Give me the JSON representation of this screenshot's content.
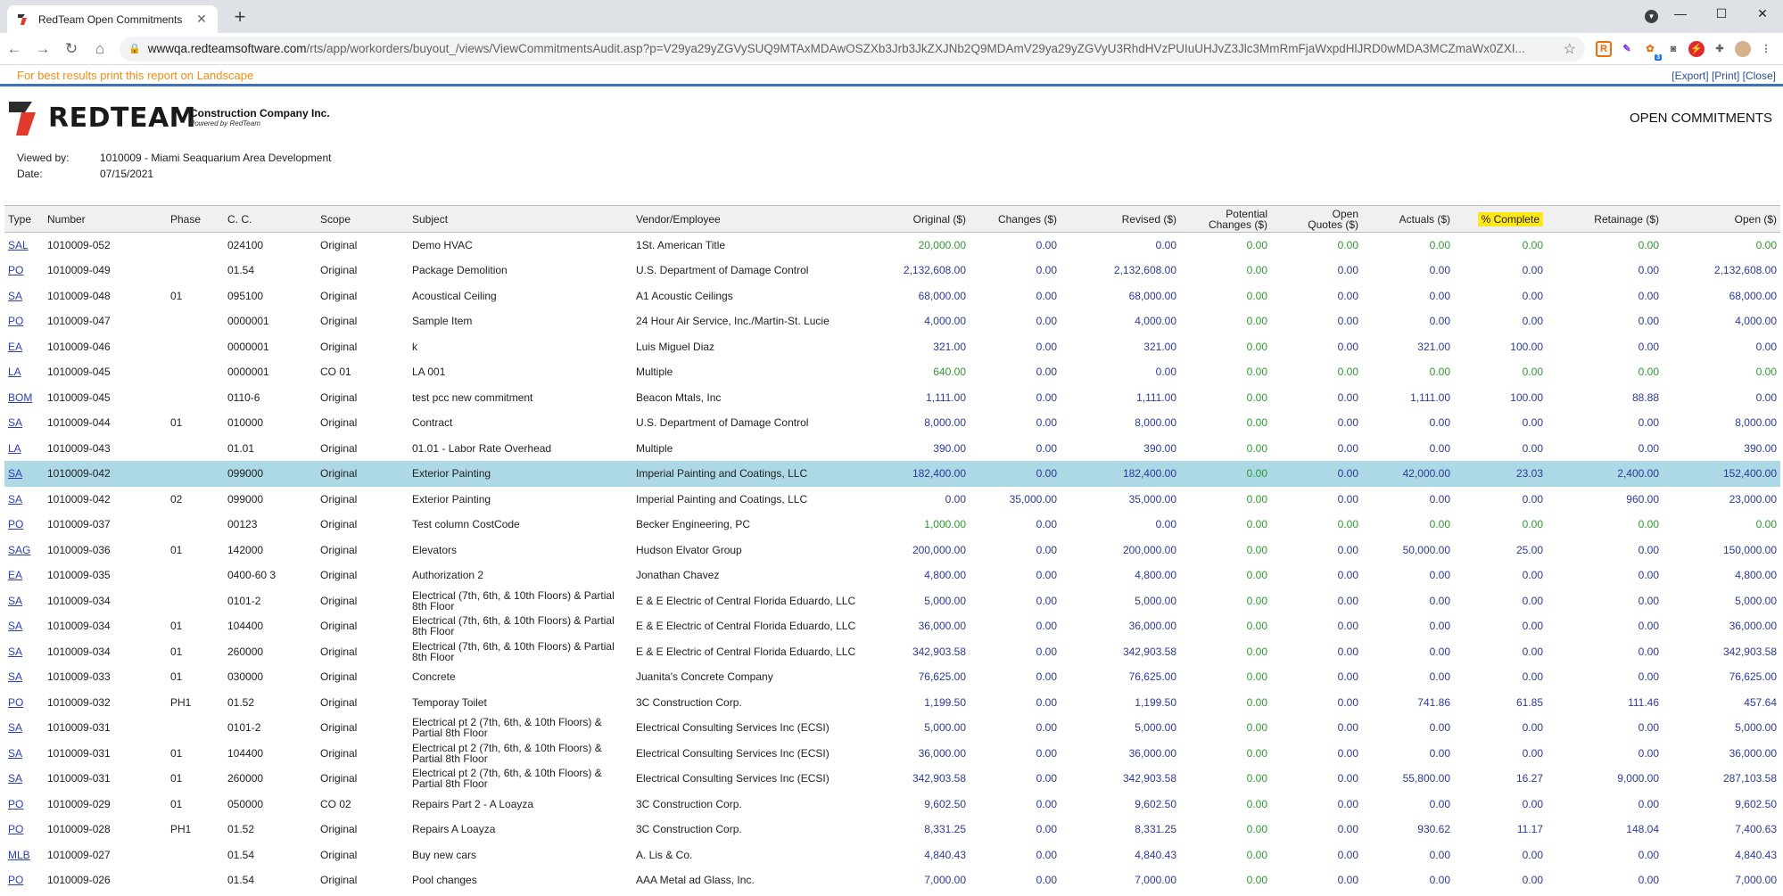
{
  "browser": {
    "tab_title": "RedTeam Open Commitments",
    "url_host": "wwwqa.redteamsoftware.com",
    "url_rest": "/rts/app/workorders/buyout_/views/ViewCommitmentsAudit.asp?p=V29ya29yZGVySUQ9MTAxMDAwOSZXb3Jrb3JkZXJNb2Q9MDAmV29ya29yZGVyU3RhdHVzPUIuUHJvZ3Jlc3MmRmFjaWxpdHlJRD0wMDA3MCZmaWx0ZXI...",
    "ext_badge": "3"
  },
  "report_bar": {
    "hint": "For best results print this report on Landscape",
    "export": "[Export]",
    "print": "[Print]",
    "close": "[Close]"
  },
  "header": {
    "logo_word": "REDTEAM",
    "company": "Construction Company Inc.",
    "powered": "Powered by RedTeam",
    "report_title": "OPEN COMMITMENTS",
    "viewed_by_label": "Viewed by:",
    "viewed_by": "1010009 - Miami Seaquarium Area Development",
    "date_label": "Date:",
    "date": "07/15/2021"
  },
  "columns": {
    "type": "Type",
    "number": "Number",
    "phase": "Phase",
    "cc": "C. C.",
    "scope": "Scope",
    "subject": "Subject",
    "vendor": "Vendor/Employee",
    "original": "Original ($)",
    "changes": "Changes ($)",
    "revised": "Revised ($)",
    "potential_1": "Potential",
    "potential_2": "Changes ($)",
    "open_quotes_1": "Open",
    "open_quotes_2": "Quotes ($)",
    "actuals": "Actuals ($)",
    "pct_complete": "% Complete",
    "retainage": "Retainage ($)",
    "open": "Open ($)"
  },
  "rows": [
    {
      "type": "SAL",
      "number": "1010009-052",
      "phase": "",
      "cc": "024100",
      "scope": "Original",
      "subject": "Demo HVAC",
      "vendor": "1St. American Title",
      "original": "20,000.00",
      "changes": "0.00",
      "revised": "0.00",
      "potential": "0.00",
      "quotes": "0.00",
      "actuals": "0.00",
      "pct": "0.00",
      "retainage": "0.00",
      "open": "0.00",
      "green": [
        "original",
        "potential",
        "quotes",
        "actuals",
        "pct",
        "retainage",
        "open"
      ]
    },
    {
      "type": "PO",
      "number": "1010009-049",
      "phase": "",
      "cc": "01.54",
      "scope": "Original",
      "subject": "Package Demolition",
      "vendor": "U.S. Department of Damage Control",
      "original": "2,132,608.00",
      "changes": "0.00",
      "revised": "2,132,608.00",
      "potential": "0.00",
      "quotes": "0.00",
      "actuals": "0.00",
      "pct": "0.00",
      "retainage": "0.00",
      "open": "2,132,608.00",
      "green": [
        "potential"
      ]
    },
    {
      "type": "SA",
      "number": "1010009-048",
      "phase": "01",
      "cc": "095100",
      "scope": "Original",
      "subject": "Acoustical Ceiling",
      "vendor": "A1 Acoustic Ceilings",
      "original": "68,000.00",
      "changes": "0.00",
      "revised": "68,000.00",
      "potential": "0.00",
      "quotes": "0.00",
      "actuals": "0.00",
      "pct": "0.00",
      "retainage": "0.00",
      "open": "68,000.00",
      "green": [
        "potential"
      ]
    },
    {
      "type": "PO",
      "number": "1010009-047",
      "phase": "",
      "cc": "0000001",
      "scope": "Original",
      "subject": "Sample Item",
      "vendor": "24 Hour Air Service, Inc./Martin-St. Lucie",
      "original": "4,000.00",
      "changes": "0.00",
      "revised": "4,000.00",
      "potential": "0.00",
      "quotes": "0.00",
      "actuals": "0.00",
      "pct": "0.00",
      "retainage": "0.00",
      "open": "4,000.00",
      "green": [
        "potential"
      ]
    },
    {
      "type": "EA",
      "number": "1010009-046",
      "phase": "",
      "cc": "0000001",
      "scope": "Original",
      "subject": "k",
      "vendor": "Luis Miguel Diaz",
      "original": "321.00",
      "changes": "0.00",
      "revised": "321.00",
      "potential": "0.00",
      "quotes": "0.00",
      "actuals": "321.00",
      "pct": "100.00",
      "retainage": "0.00",
      "open": "0.00",
      "green": [
        "potential"
      ]
    },
    {
      "type": "LA",
      "number": "1010009-045",
      "phase": "",
      "cc": "0000001",
      "scope": "CO 01",
      "subject": "LA 001",
      "vendor": "Multiple",
      "original": "640.00",
      "changes": "0.00",
      "revised": "0.00",
      "potential": "0.00",
      "quotes": "0.00",
      "actuals": "0.00",
      "pct": "0.00",
      "retainage": "0.00",
      "open": "0.00",
      "green": [
        "original",
        "potential",
        "quotes",
        "actuals",
        "pct",
        "retainage",
        "open"
      ]
    },
    {
      "type": "BOM",
      "number": "1010009-045",
      "phase": "",
      "cc": "0110-6",
      "scope": "Original",
      "subject": "test pcc new commitment",
      "vendor": "Beacon Mtals, Inc",
      "original": "1,111.00",
      "changes": "0.00",
      "revised": "1,111.00",
      "potential": "0.00",
      "quotes": "0.00",
      "actuals": "1,111.00",
      "pct": "100.00",
      "retainage": "88.88",
      "open": "0.00",
      "green": [
        "potential"
      ]
    },
    {
      "type": "SA",
      "number": "1010009-044",
      "phase": "01",
      "cc": "010000",
      "scope": "Original",
      "subject": "Contract",
      "vendor": "U.S. Department of Damage Control",
      "original": "8,000.00",
      "changes": "0.00",
      "revised": "8,000.00",
      "potential": "0.00",
      "quotes": "0.00",
      "actuals": "0.00",
      "pct": "0.00",
      "retainage": "0.00",
      "open": "8,000.00",
      "green": [
        "potential"
      ]
    },
    {
      "type": "LA",
      "number": "1010009-043",
      "phase": "",
      "cc": "01.01",
      "scope": "Original",
      "subject": "01.01 - Labor Rate Overhead",
      "vendor": "Multiple",
      "original": "390.00",
      "changes": "0.00",
      "revised": "390.00",
      "potential": "0.00",
      "quotes": "0.00",
      "actuals": "0.00",
      "pct": "0.00",
      "retainage": "0.00",
      "open": "390.00",
      "green": [
        "potential"
      ]
    },
    {
      "type": "SA",
      "number": "1010009-042",
      "phase": "",
      "cc": "099000",
      "scope": "Original",
      "subject": "Exterior Painting",
      "vendor": "Imperial Painting and Coatings, LLC",
      "original": "182,400.00",
      "changes": "0.00",
      "revised": "182,400.00",
      "potential": "0.00",
      "quotes": "0.00",
      "actuals": "42,000.00",
      "pct": "23.03",
      "retainage": "2,400.00",
      "open": "152,400.00",
      "green": [
        "potential"
      ],
      "selected": true
    },
    {
      "type": "SA",
      "number": "1010009-042",
      "phase": "02",
      "cc": "099000",
      "scope": "Original",
      "subject": "Exterior Painting",
      "vendor": "Imperial Painting and Coatings, LLC",
      "original": "0.00",
      "changes": "35,000.00",
      "revised": "35,000.00",
      "potential": "0.00",
      "quotes": "0.00",
      "actuals": "0.00",
      "pct": "0.00",
      "retainage": "960.00",
      "open": "23,000.00",
      "green": [
        "potential"
      ]
    },
    {
      "type": "PO",
      "number": "1010009-037",
      "phase": "",
      "cc": "00123",
      "scope": "Original",
      "subject": "Test column CostCode",
      "vendor": "Becker Engineering, PC",
      "original": "1,000.00",
      "changes": "0.00",
      "revised": "0.00",
      "potential": "0.00",
      "quotes": "0.00",
      "actuals": "0.00",
      "pct": "0.00",
      "retainage": "0.00",
      "open": "0.00",
      "green": [
        "original",
        "potential",
        "quotes",
        "actuals",
        "pct",
        "retainage",
        "open"
      ]
    },
    {
      "type": "SAG",
      "number": "1010009-036",
      "phase": "01",
      "cc": "142000",
      "scope": "Original",
      "subject": "Elevators",
      "vendor": "Hudson Elvator Group",
      "original": "200,000.00",
      "changes": "0.00",
      "revised": "200,000.00",
      "potential": "0.00",
      "quotes": "0.00",
      "actuals": "50,000.00",
      "pct": "25.00",
      "retainage": "0.00",
      "open": "150,000.00",
      "green": [
        "potential"
      ]
    },
    {
      "type": "EA",
      "number": "1010009-035",
      "phase": "",
      "cc": "0400-60 3",
      "scope": "Original",
      "subject": "Authorization 2",
      "vendor": "Jonathan Chavez",
      "original": "4,800.00",
      "changes": "0.00",
      "revised": "4,800.00",
      "potential": "0.00",
      "quotes": "0.00",
      "actuals": "0.00",
      "pct": "0.00",
      "retainage": "0.00",
      "open": "4,800.00",
      "green": [
        "potential"
      ]
    },
    {
      "type": "SA",
      "number": "1010009-034",
      "phase": "",
      "cc": "0101-2",
      "scope": "Original",
      "subject": "Electrical (7th, 6th, & 10th Floors) & Partial 8th Floor",
      "vendor": "E & E Electric of Central Florida Eduardo, LLC",
      "original": "5,000.00",
      "changes": "0.00",
      "revised": "5,000.00",
      "potential": "0.00",
      "quotes": "0.00",
      "actuals": "0.00",
      "pct": "0.00",
      "retainage": "0.00",
      "open": "5,000.00",
      "green": [
        "potential"
      ]
    },
    {
      "type": "SA",
      "number": "1010009-034",
      "phase": "01",
      "cc": "104400",
      "scope": "Original",
      "subject": "Electrical (7th, 6th, & 10th Floors) & Partial 8th Floor",
      "vendor": "E & E Electric of Central Florida Eduardo, LLC",
      "original": "36,000.00",
      "changes": "0.00",
      "revised": "36,000.00",
      "potential": "0.00",
      "quotes": "0.00",
      "actuals": "0.00",
      "pct": "0.00",
      "retainage": "0.00",
      "open": "36,000.00",
      "green": [
        "potential"
      ]
    },
    {
      "type": "SA",
      "number": "1010009-034",
      "phase": "01",
      "cc": "260000",
      "scope": "Original",
      "subject": "Electrical (7th, 6th, & 10th Floors) & Partial 8th Floor",
      "vendor": "E & E Electric of Central Florida Eduardo, LLC",
      "original": "342,903.58",
      "changes": "0.00",
      "revised": "342,903.58",
      "potential": "0.00",
      "quotes": "0.00",
      "actuals": "0.00",
      "pct": "0.00",
      "retainage": "0.00",
      "open": "342,903.58",
      "green": [
        "potential"
      ]
    },
    {
      "type": "SA",
      "number": "1010009-033",
      "phase": "01",
      "cc": "030000",
      "scope": "Original",
      "subject": "Concrete",
      "vendor": "Juanita's Concrete Company",
      "original": "76,625.00",
      "changes": "0.00",
      "revised": "76,625.00",
      "potential": "0.00",
      "quotes": "0.00",
      "actuals": "0.00",
      "pct": "0.00",
      "retainage": "0.00",
      "open": "76,625.00",
      "green": [
        "potential"
      ]
    },
    {
      "type": "PO",
      "number": "1010009-032",
      "phase": "PH1",
      "cc": "01.52",
      "scope": "Original",
      "subject": "Temporay Toilet",
      "vendor": "3C Construction Corp.",
      "original": "1,199.50",
      "changes": "0.00",
      "revised": "1,199.50",
      "potential": "0.00",
      "quotes": "0.00",
      "actuals": "741.86",
      "pct": "61.85",
      "retainage": "111.46",
      "open": "457.64",
      "green": [
        "potential"
      ]
    },
    {
      "type": "SA",
      "number": "1010009-031",
      "phase": "",
      "cc": "0101-2",
      "scope": "Original",
      "subject": "Electrical pt 2 (7th, 6th, & 10th Floors) & Partial 8th Floor",
      "vendor": "Electrical Consulting Services Inc (ECSI)",
      "original": "5,000.00",
      "changes": "0.00",
      "revised": "5,000.00",
      "potential": "0.00",
      "quotes": "0.00",
      "actuals": "0.00",
      "pct": "0.00",
      "retainage": "0.00",
      "open": "5,000.00",
      "green": [
        "potential"
      ]
    },
    {
      "type": "SA",
      "number": "1010009-031",
      "phase": "01",
      "cc": "104400",
      "scope": "Original",
      "subject": "Electrical pt 2 (7th, 6th, & 10th Floors) & Partial 8th Floor",
      "vendor": "Electrical Consulting Services Inc (ECSI)",
      "original": "36,000.00",
      "changes": "0.00",
      "revised": "36,000.00",
      "potential": "0.00",
      "quotes": "0.00",
      "actuals": "0.00",
      "pct": "0.00",
      "retainage": "0.00",
      "open": "36,000.00",
      "green": [
        "potential"
      ]
    },
    {
      "type": "SA",
      "number": "1010009-031",
      "phase": "01",
      "cc": "260000",
      "scope": "Original",
      "subject": "Electrical pt 2 (7th, 6th, & 10th Floors) & Partial 8th Floor",
      "vendor": "Electrical Consulting Services Inc (ECSI)",
      "original": "342,903.58",
      "changes": "0.00",
      "revised": "342,903.58",
      "potential": "0.00",
      "quotes": "0.00",
      "actuals": "55,800.00",
      "pct": "16.27",
      "retainage": "9,000.00",
      "open": "287,103.58",
      "green": [
        "potential"
      ]
    },
    {
      "type": "PO",
      "number": "1010009-029",
      "phase": "01",
      "cc": "050000",
      "scope": "CO 02",
      "subject": "Repairs Part 2 - A Loayza",
      "vendor": "3C Construction Corp.",
      "original": "9,602.50",
      "changes": "0.00",
      "revised": "9,602.50",
      "potential": "0.00",
      "quotes": "0.00",
      "actuals": "0.00",
      "pct": "0.00",
      "retainage": "0.00",
      "open": "9,602.50",
      "green": [
        "potential"
      ]
    },
    {
      "type": "PO",
      "number": "1010009-028",
      "phase": "PH1",
      "cc": "01.52",
      "scope": "Original",
      "subject": "Repairs A Loayza",
      "vendor": "3C Construction Corp.",
      "original": "8,331.25",
      "changes": "0.00",
      "revised": "8,331.25",
      "potential": "0.00",
      "quotes": "0.00",
      "actuals": "930.62",
      "pct": "11.17",
      "retainage": "148.04",
      "open": "7,400.63",
      "green": [
        "potential"
      ]
    },
    {
      "type": "MLB",
      "number": "1010009-027",
      "phase": "",
      "cc": "01.54",
      "scope": "Original",
      "subject": "Buy new cars",
      "vendor": "A. Lis & Co.",
      "original": "4,840.43",
      "changes": "0.00",
      "revised": "4,840.43",
      "potential": "0.00",
      "quotes": "0.00",
      "actuals": "0.00",
      "pct": "0.00",
      "retainage": "0.00",
      "open": "4,840.43",
      "green": [
        "potential"
      ]
    },
    {
      "type": "PO",
      "number": "1010009-026",
      "phase": "",
      "cc": "01.54",
      "scope": "Original",
      "subject": "Pool changes",
      "vendor": "AAA Metal ad Glass, Inc.",
      "original": "7,000.00",
      "changes": "0.00",
      "revised": "7,000.00",
      "potential": "0.00",
      "quotes": "0.00",
      "actuals": "0.00",
      "pct": "0.00",
      "retainage": "0.00",
      "open": "7,000.00",
      "green": [
        "potential"
      ]
    }
  ]
}
